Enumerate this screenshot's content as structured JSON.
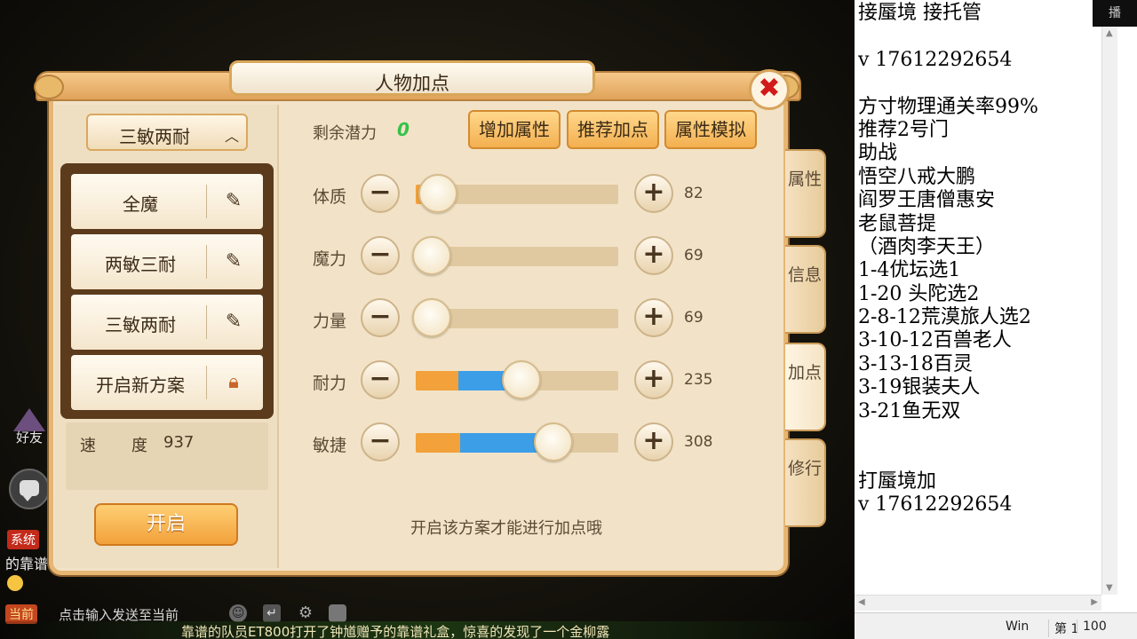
{
  "game": {
    "panel_title": "人物加点",
    "close_symbol": "✖",
    "scheme_selected": "三敏两耐",
    "schemes": [
      {
        "name": "全魔",
        "icon": "edit-icon"
      },
      {
        "name": "两敏三耐",
        "icon": "edit-icon"
      },
      {
        "name": "三敏两耐",
        "icon": "edit-icon"
      },
      {
        "name": "开启新方案",
        "icon": "lock-icon"
      }
    ],
    "speed_label": "速度",
    "speed_value": "937",
    "enable_button": "开启",
    "remaining_label": "剩余潜力",
    "remaining_value": "0",
    "top_buttons": {
      "add_attr": "增加属性",
      "recommend": "推荐加点",
      "simulate": "属性模拟"
    },
    "attributes": [
      {
        "label": "体质",
        "value": "82",
        "base_fraction": 0.11,
        "extra_fraction": 0.0
      },
      {
        "label": "魔力",
        "value": "69",
        "base_fraction": 0.08,
        "extra_fraction": 0.0
      },
      {
        "label": "力量",
        "value": "69",
        "base_fraction": 0.08,
        "extra_fraction": 0.0
      },
      {
        "label": "耐力",
        "value": "235",
        "base_fraction": 0.21,
        "extra_fraction": 0.31
      },
      {
        "label": "敏捷",
        "value": "308",
        "base_fraction": 0.22,
        "extra_fraction": 0.46
      }
    ],
    "notice": "开启该方案才能进行加点哦",
    "side_tabs": [
      "属性",
      "信息",
      "加点",
      "修行"
    ],
    "colors": {
      "base_fill": "#f2a13b",
      "extra_fill": "#3d9ee8",
      "remaining": "#34c24a",
      "close": "#d21a1a"
    }
  },
  "chat": {
    "friends_label": "好友",
    "system_tag": "系统",
    "chat_line": "的靠谱",
    "channel_tag": "当前",
    "input_placeholder": "点击输入发送至当前",
    "ticker_text": "靠谱的队员ET800打开了钟馗赠予的靠谱礼盒，惊喜的发现了一个金柳露"
  },
  "notepad": {
    "titlebar_text": "播",
    "lines": [
      "接蜃境 接托管",
      "",
      "v 17612292654",
      "",
      "方寸物理通关率99%",
      "推荐2号门",
      "助战",
      "悟空八戒大鹏",
      "阎罗王唐僧惠安",
      "老鼠菩提",
      "（酒肉李天王）",
      "1-4优坛选1",
      "1-20 头陀选2",
      "2-8-12荒漠旅人选2",
      "3-10-12百兽老人",
      "3-13-18百灵",
      "3-19银装夫人",
      "3-21鱼无双",
      "",
      "",
      "打蜃境加",
      "v 17612292654"
    ],
    "status_eol": "Win",
    "status_pos": "第 1",
    "status_zoom": "100"
  }
}
